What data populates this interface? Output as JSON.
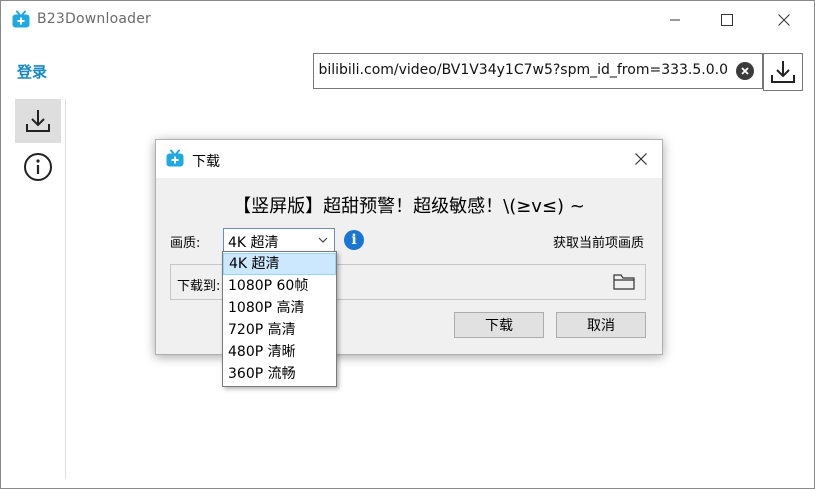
{
  "app": {
    "title": "B23Downloader"
  },
  "toolbar": {
    "login_label": "登录",
    "url_value": "bilibili.com/video/BV1V34y1C7w5?spm_id_from=333.5.0.0"
  },
  "dialog": {
    "title": "下载",
    "video_title": "【竖屏版】超甜预警！超级敏感！\\(≥v≤) ~",
    "quality_label": "画质:",
    "quality_selected": "4K 超清",
    "get_current_quality": "获取当前项画质",
    "save_to_label": "下载到:",
    "download_button": "下载",
    "cancel_button": "取消"
  },
  "quality_options": [
    "4K 超清",
    "1080P 60帧",
    "1080P 高清",
    "720P 高清",
    "480P 清晰",
    "360P 流畅"
  ],
  "colors": {
    "accent": "#1688c6",
    "icon_blue": "#20a8e0",
    "selected_bg": "#cce8ff",
    "info_blue": "#1976d2"
  },
  "icons": [
    "app-tv-icon",
    "download-icon",
    "info-icon",
    "close-icon",
    "folder-icon",
    "chevron-down-icon"
  ]
}
